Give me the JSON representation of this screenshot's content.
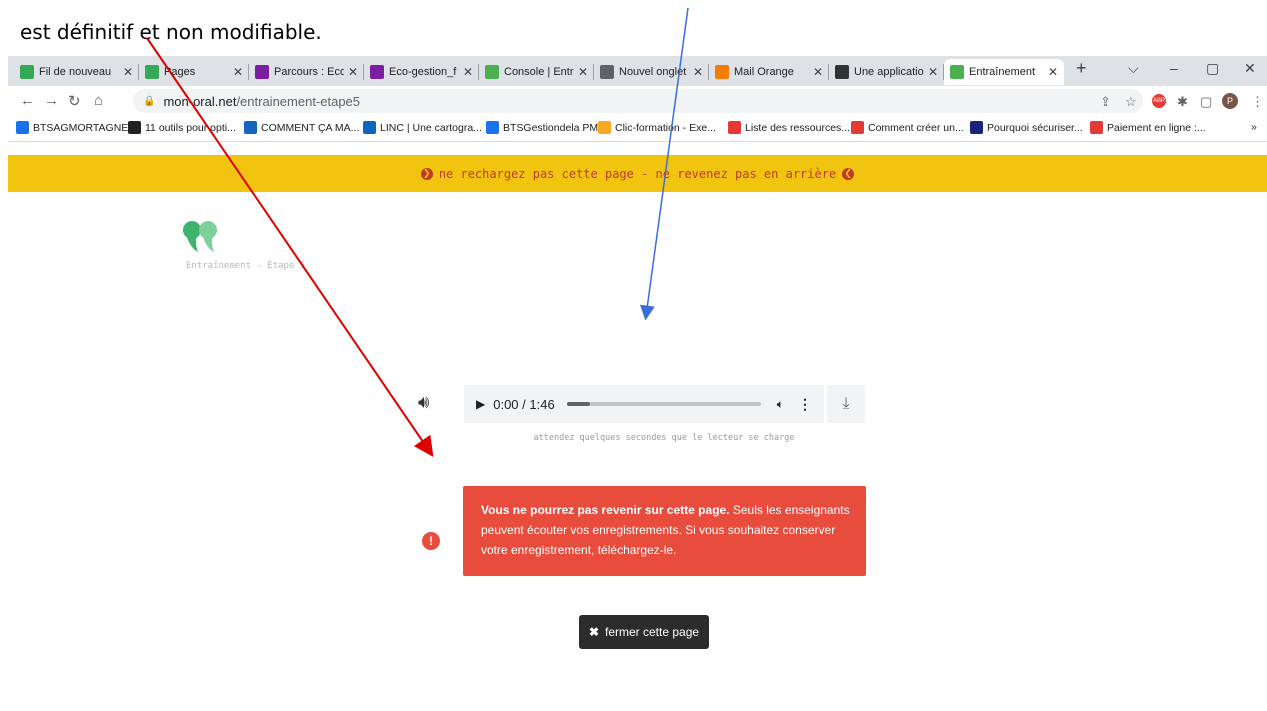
{
  "caption": "est définitif et non modifiable.",
  "tabs": [
    {
      "label": "Fil de nouveau",
      "icon": "classroom-icon",
      "color": "#34a853"
    },
    {
      "label": "Pages",
      "icon": "classroom-icon",
      "color": "#34a853"
    },
    {
      "label": "Parcours : Eco",
      "icon": "m-icon",
      "color": "#7b1fa2"
    },
    {
      "label": "Eco-gestion_f",
      "icon": "m-icon",
      "color": "#7b1fa2"
    },
    {
      "label": "Console | Entr",
      "icon": "mon-oral-icon",
      "color": "#4caf50"
    },
    {
      "label": "Nouvel onglet",
      "icon": "chrome-icon",
      "color": "#5f6368"
    },
    {
      "label": "Mail Orange",
      "icon": "mail-icon",
      "color": "#f57c00"
    },
    {
      "label": "Une applicatio",
      "icon": "app-icon",
      "color": "#333333"
    },
    {
      "label": "Entraînement",
      "icon": "mon-oral-icon",
      "color": "#4caf50",
      "active": true
    }
  ],
  "new_tab": "+",
  "window": {
    "dropdown": "⌵",
    "minimize": "–",
    "restore": "▢",
    "close": "✕"
  },
  "address": {
    "host": "mon-oral.net",
    "path": "/entrainement-etape5"
  },
  "bookmarks": [
    {
      "label": "BTSAGMORTAGNE",
      "icon": "calendar-icon",
      "color": "#1a73e8"
    },
    {
      "label": "11 outils pour opti...",
      "icon": "puzzle-icon",
      "color": "#222222"
    },
    {
      "label": "COMMENT ÇA MA...",
      "icon": "ccm-icon",
      "color": "#1565c0"
    },
    {
      "label": "LINC | Une cartogra...",
      "icon": "linkedin-icon",
      "color": "#0a66c2"
    },
    {
      "label": "BTSGestiondela PME",
      "icon": "calendar-icon",
      "color": "#1a73e8"
    },
    {
      "label": "Clic-formation - Exe...",
      "icon": "clic-icon",
      "color": "#f9a825"
    },
    {
      "label": "Liste des ressources...",
      "icon": "marianne-icon",
      "color": "#e53935"
    },
    {
      "label": "Comment créer un...",
      "icon": "marianne-icon",
      "color": "#e53935"
    },
    {
      "label": "Pourquoi sécuriser...",
      "icon": "c-icon",
      "color": "#1a237e"
    },
    {
      "label": "Paiement en ligne :...",
      "icon": "marianne-icon",
      "color": "#e53935"
    }
  ],
  "bookmarks_more": "»",
  "warning_bar": "ne rechargez pas cette page - ne revenez pas en arrière",
  "step_label": "Entraînement - Étape 5",
  "player": {
    "time": "0:00 / 1:46",
    "progress": 0.12
  },
  "player_hint": "attendez quelques secondes que le lecteur se charge",
  "alert": {
    "bold": "Vous ne pourrez pas revenir sur cette page.",
    "text": " Seuls les enseignants peuvent écouter vos enregistrements. Si vous souhaitez conserver votre enregistrement, téléchargez-le."
  },
  "close_button": "fermer cette page",
  "colors": {
    "warning": "#f1c40f",
    "alert": "#e74c3c",
    "red_arrow": "#e00000",
    "blue_arrow": "#3a6fd8"
  }
}
